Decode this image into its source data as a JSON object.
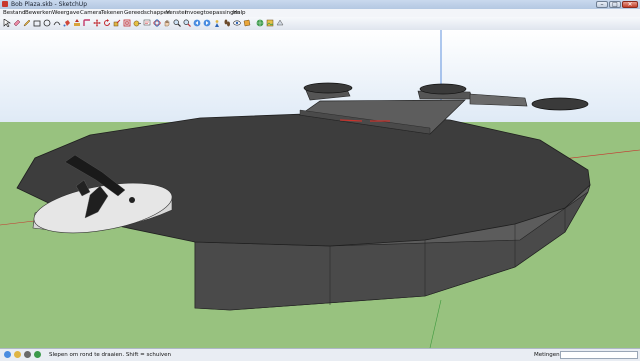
{
  "window": {
    "title": "Bob Plaza.skb - SketchUp",
    "min_glyph": "–",
    "max_glyph": "□",
    "close_glyph": "✕"
  },
  "menu": {
    "items": [
      "Bestand",
      "Bewerken",
      "Weergave",
      "Camera",
      "Tekenen",
      "Gereedschappen",
      "Venster",
      "Invoegtoepassingen",
      "Help"
    ]
  },
  "toolbar": {
    "tools": [
      "select-arrow-icon",
      "eraser-icon",
      "pencil-line-icon",
      "rectangle-icon",
      "circle-icon",
      "arc-icon",
      "paint-bucket-icon",
      "push-pull-icon",
      "follow-me-icon",
      "move-icon",
      "rotate-icon",
      "scale-icon",
      "offset-icon",
      "tape-measure-icon",
      "text-icon",
      "orbit-icon",
      "pan-icon",
      "zoom-icon",
      "zoom-extents-icon",
      "previous-view-icon",
      "next-view-icon",
      "position-camera-icon",
      "walk-icon",
      "look-around-icon",
      "section-plane-icon",
      "add-location-icon",
      "photo-textures-icon"
    ]
  },
  "viewport": {
    "background": "#ffffff",
    "ground_color": "#98c27f",
    "sky_color": "#dfeaf6",
    "model_color": "#3d3d3d"
  },
  "status": {
    "hint": "Slepen om rond te draaien. Shift = schuiven",
    "measurements_label": "Metingen",
    "measurements_value": ""
  }
}
